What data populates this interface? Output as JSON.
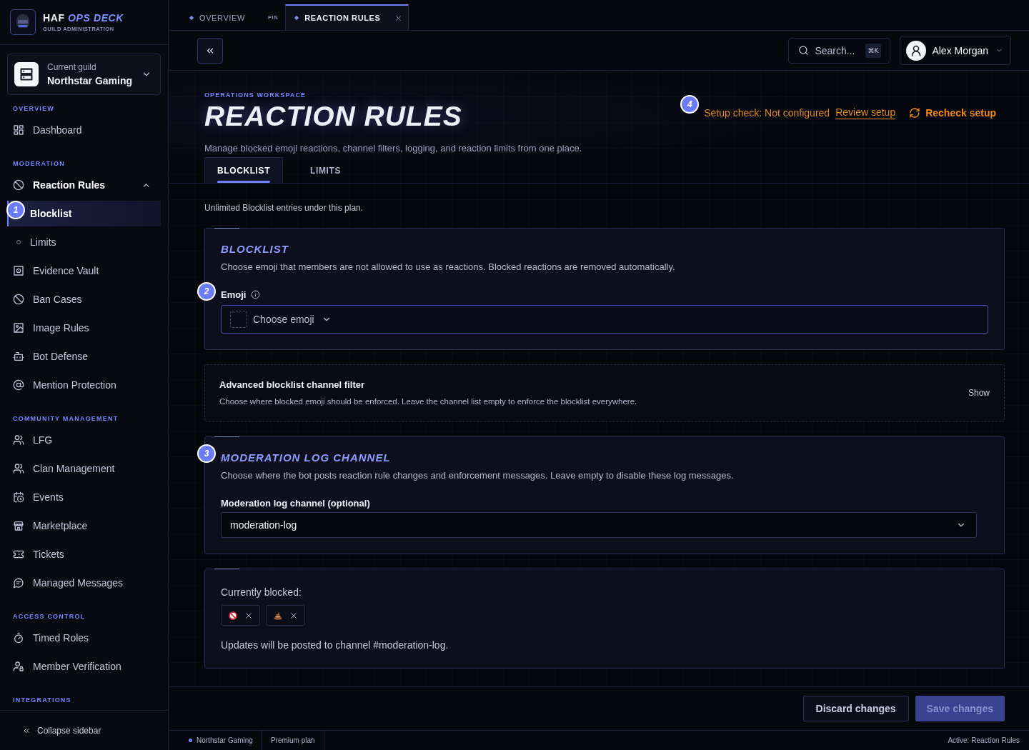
{
  "sidebar": {
    "brand": {
      "name": "HAF *OPS DECK*",
      "subtitle": "GUILD ADMINISTRATION"
    },
    "guild_picker": {
      "label": "Current guild",
      "value": "Northstar Gaming"
    },
    "sections": [
      {
        "heading": "OVERVIEW",
        "items": [
          {
            "label": "Dashboard",
            "selected": false
          }
        ]
      },
      {
        "heading": "MODERATION",
        "items": [
          {
            "label": "Reaction Rules",
            "selected": false,
            "expanded": true,
            "children": [
              {
                "label": "Blocklist",
                "selected": true,
                "step": "1"
              },
              {
                "label": "Limits",
                "selected": false
              }
            ]
          },
          {
            "label": "Evidence Vault",
            "selected": false
          },
          {
            "label": "Ban Cases",
            "selected": false
          },
          {
            "label": "Image Rules",
            "selected": false
          },
          {
            "label": "Bot Defense",
            "selected": false
          },
          {
            "label": "Mention Protection",
            "selected": false
          }
        ]
      },
      {
        "heading": "COMMUNITY MANAGEMENT",
        "items": [
          {
            "label": "LFG",
            "selected": false
          },
          {
            "label": "Clan Management",
            "selected": false
          },
          {
            "label": "Events",
            "selected": false
          },
          {
            "label": "Marketplace",
            "selected": false
          },
          {
            "label": "Tickets",
            "selected": false
          },
          {
            "label": "Managed Messages",
            "selected": false
          }
        ]
      },
      {
        "heading": "ACCESS CONTROL",
        "items": [
          {
            "label": "Timed Roles",
            "selected": false
          },
          {
            "label": "Member Verification",
            "selected": false
          }
        ]
      },
      {
        "heading": "INTEGRATIONS"
      }
    ],
    "collapse_button": "Collapse sidebar"
  },
  "tabs": [
    {
      "label": "OVERVIEW",
      "selected": false,
      "pin": "PIN",
      "closable": false
    },
    {
      "label": "REACTION RULES",
      "selected": true,
      "closable": true
    }
  ],
  "toolbar": {
    "search": {
      "placeholder": "Search...",
      "shortcut": "⌘K"
    },
    "user": {
      "name": "Alex Morgan"
    }
  },
  "header": {
    "eyebrow": "OPERATIONS WORKSPACE",
    "title": "REACTION RULES",
    "description": "Manage blocked emoji reactions, channel filters, logging, and reaction limits from one place.",
    "setup_check": {
      "step": "4",
      "status": "Setup check: Not configured",
      "link": "Review setup",
      "button": "Recheck setup"
    }
  },
  "page_tabs": [
    {
      "label": "BLOCKLIST",
      "selected": true
    },
    {
      "label": "LIMITS",
      "selected": false
    }
  ],
  "plan_note": "Unlimited Blocklist entries under this plan.",
  "cards": [
    {
      "kind": "form",
      "title": "BLOCKLIST",
      "description": "Choose emoji that members are not allowed to use as reactions. Blocked reactions are removed automatically.",
      "field": {
        "kind": "emoji-picker",
        "label": "Emoji",
        "step": "2",
        "info": true,
        "placeholder": "Choose emoji"
      }
    },
    {
      "kind": "collapsible",
      "title": "Advanced blocklist channel filter",
      "description": "Choose where blocked emoji should be enforced. Leave the channel list empty to enforce the blocklist everywhere.",
      "toggle": "Show"
    },
    {
      "kind": "form",
      "title": "MODERATION LOG CHANNEL",
      "step": "3",
      "description": "Choose where the bot posts reaction rule changes and enforcement messages. Leave empty to disable these log messages.",
      "field": {
        "kind": "select",
        "label": "Moderation log channel (optional)",
        "value": "moderation-log"
      }
    },
    {
      "kind": "summary",
      "label": "Currently blocked:",
      "chips": [
        {
          "kind": "prohibited"
        },
        {
          "kind": "pile"
        }
      ],
      "note": "Updates will be posted to channel #moderation-log."
    }
  ],
  "actions": [
    {
      "label": "Discard changes",
      "kind": "secondary",
      "disabled": false
    },
    {
      "label": "Save changes",
      "kind": "primary",
      "disabled": true
    }
  ],
  "status_bar": {
    "guild": "Northstar Gaming",
    "plan": "Premium plan",
    "active": "Active: Reaction Rules"
  }
}
